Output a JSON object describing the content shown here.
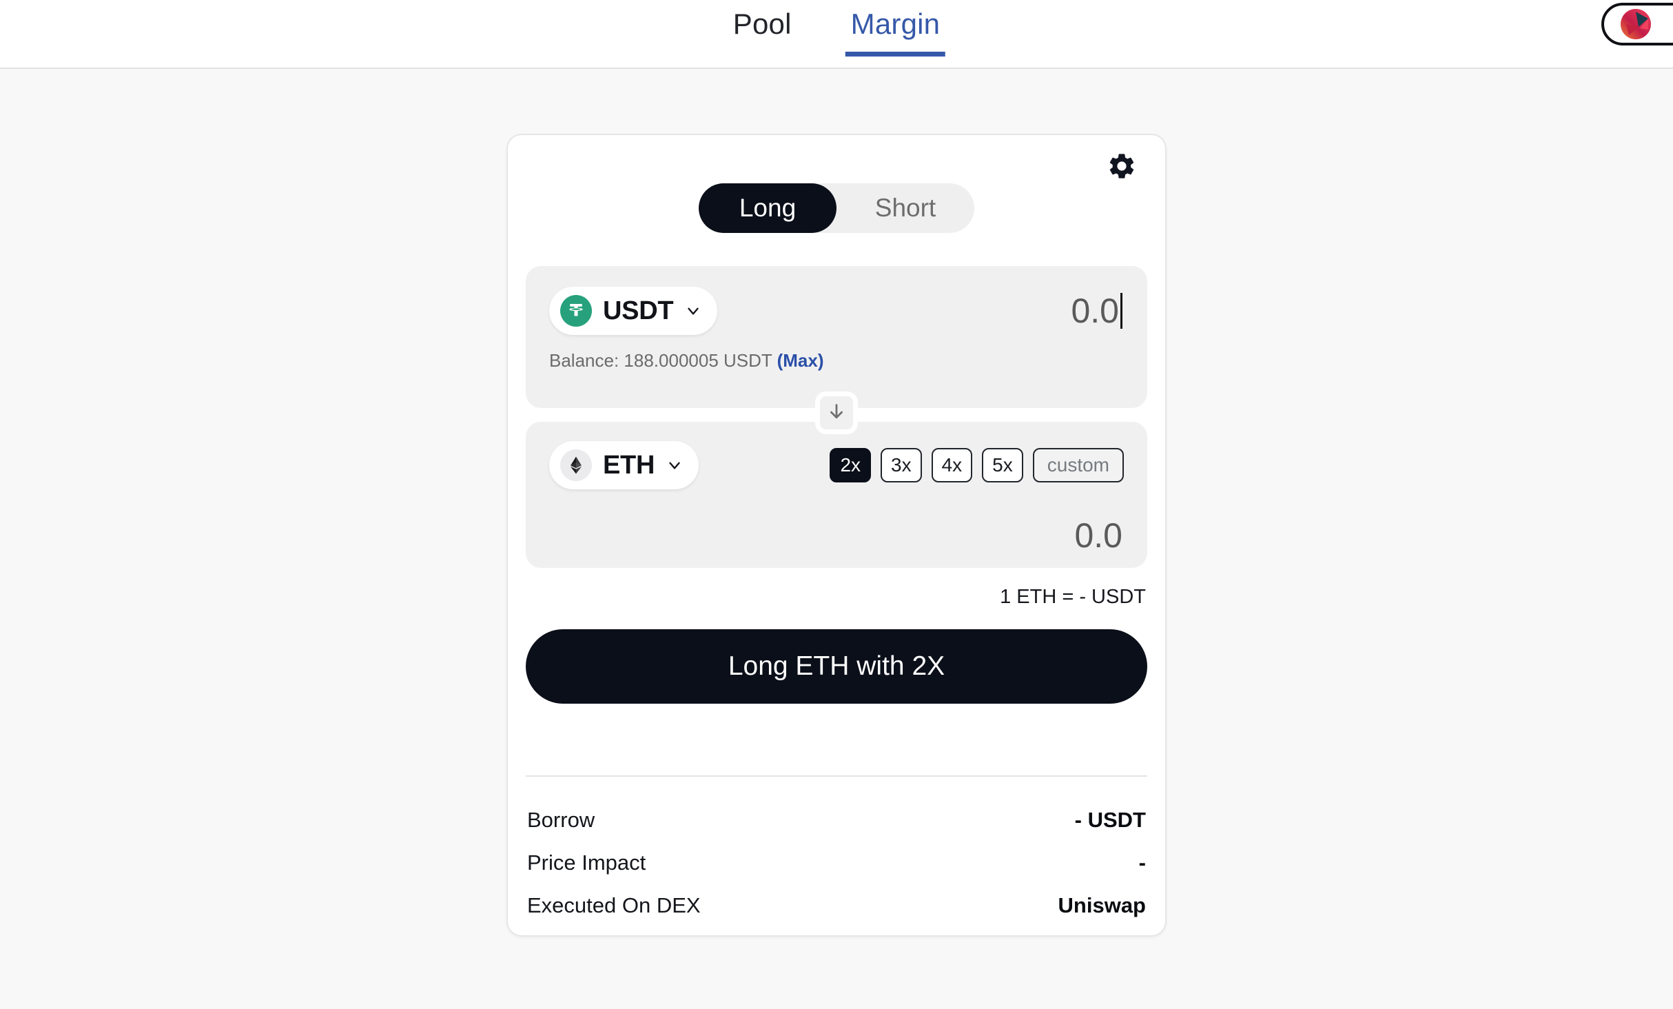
{
  "header": {
    "tabs": [
      {
        "label": "Pool",
        "active": false
      },
      {
        "label": "Margin",
        "active": true
      }
    ],
    "wallet_button": {
      "name": "wallet-connect",
      "label": ""
    },
    "accent_blue": "#3558a8"
  },
  "card": {
    "settings_icon": "gear-icon",
    "position_toggle": {
      "options": [
        {
          "label": "Long",
          "active": true
        },
        {
          "label": "Short",
          "active": false
        }
      ]
    },
    "pay": {
      "token_symbol": "USDT",
      "token_icon": "usdt-icon",
      "token_color": "#26a17b",
      "amount": "0.0",
      "balance_prefix": "Balance:",
      "balance_value": "188.000005",
      "balance_symbol": "USDT",
      "max_label": "(Max)",
      "max_color": "#2a4fa8"
    },
    "switch_icon": "arrow-down-icon",
    "receive": {
      "token_symbol": "ETH",
      "token_icon": "eth-icon",
      "amount": "0.0",
      "leverage_options": [
        {
          "label": "2x",
          "active": true,
          "custom": false
        },
        {
          "label": "3x",
          "active": false,
          "custom": false
        },
        {
          "label": "4x",
          "active": false,
          "custom": false
        },
        {
          "label": "5x",
          "active": false,
          "custom": false
        },
        {
          "label": "custom",
          "active": false,
          "custom": true
        }
      ]
    },
    "rate": "1 ETH = - USDT",
    "cta_label": "Long ETH with 2X",
    "details": [
      {
        "label": "Borrow",
        "value": "- USDT"
      },
      {
        "label": "Price Impact",
        "value": "-"
      },
      {
        "label": "Executed On DEX",
        "value": "Uniswap"
      }
    ]
  }
}
